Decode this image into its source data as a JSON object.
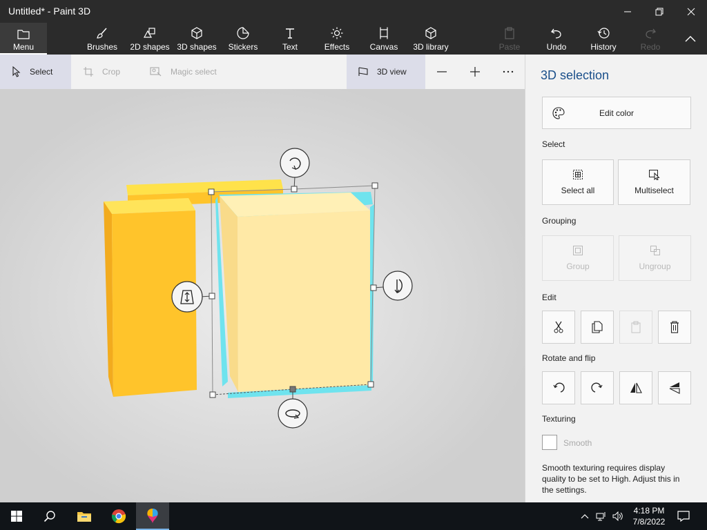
{
  "window": {
    "title": "Untitled* - Paint 3D"
  },
  "ribbon": {
    "menu": "Menu",
    "brushes": "Brushes",
    "shapes2d": "2D shapes",
    "shapes3d": "3D shapes",
    "stickers": "Stickers",
    "text": "Text",
    "effects": "Effects",
    "canvas": "Canvas",
    "library3d": "3D library",
    "paste": "Paste",
    "undo": "Undo",
    "history": "History",
    "redo": "Redo"
  },
  "toolbar": {
    "select": "Select",
    "crop": "Crop",
    "magic_select": "Magic select",
    "view3d": "3D view"
  },
  "panel": {
    "title": "3D selection",
    "edit_color": "Edit color",
    "select_heading": "Select",
    "select_all": "Select all",
    "multiselect": "Multiselect",
    "grouping_heading": "Grouping",
    "group": "Group",
    "ungroup": "Ungroup",
    "edit_heading": "Edit",
    "rotate_heading": "Rotate and flip",
    "texturing_heading": "Texturing",
    "smooth": "Smooth",
    "smooth_checked": false,
    "smooth_note": "Smooth texturing requires display quality to be set to High. Adjust this in the settings."
  },
  "taskbar": {
    "time": "4:18 PM",
    "date": "7/8/2022"
  },
  "colors": {
    "accent_blue": "#1a4f8a",
    "selection_cyan": "#6fe3ee",
    "object_orange": "#ffc42b",
    "selected_object": "#ffe9a6"
  }
}
